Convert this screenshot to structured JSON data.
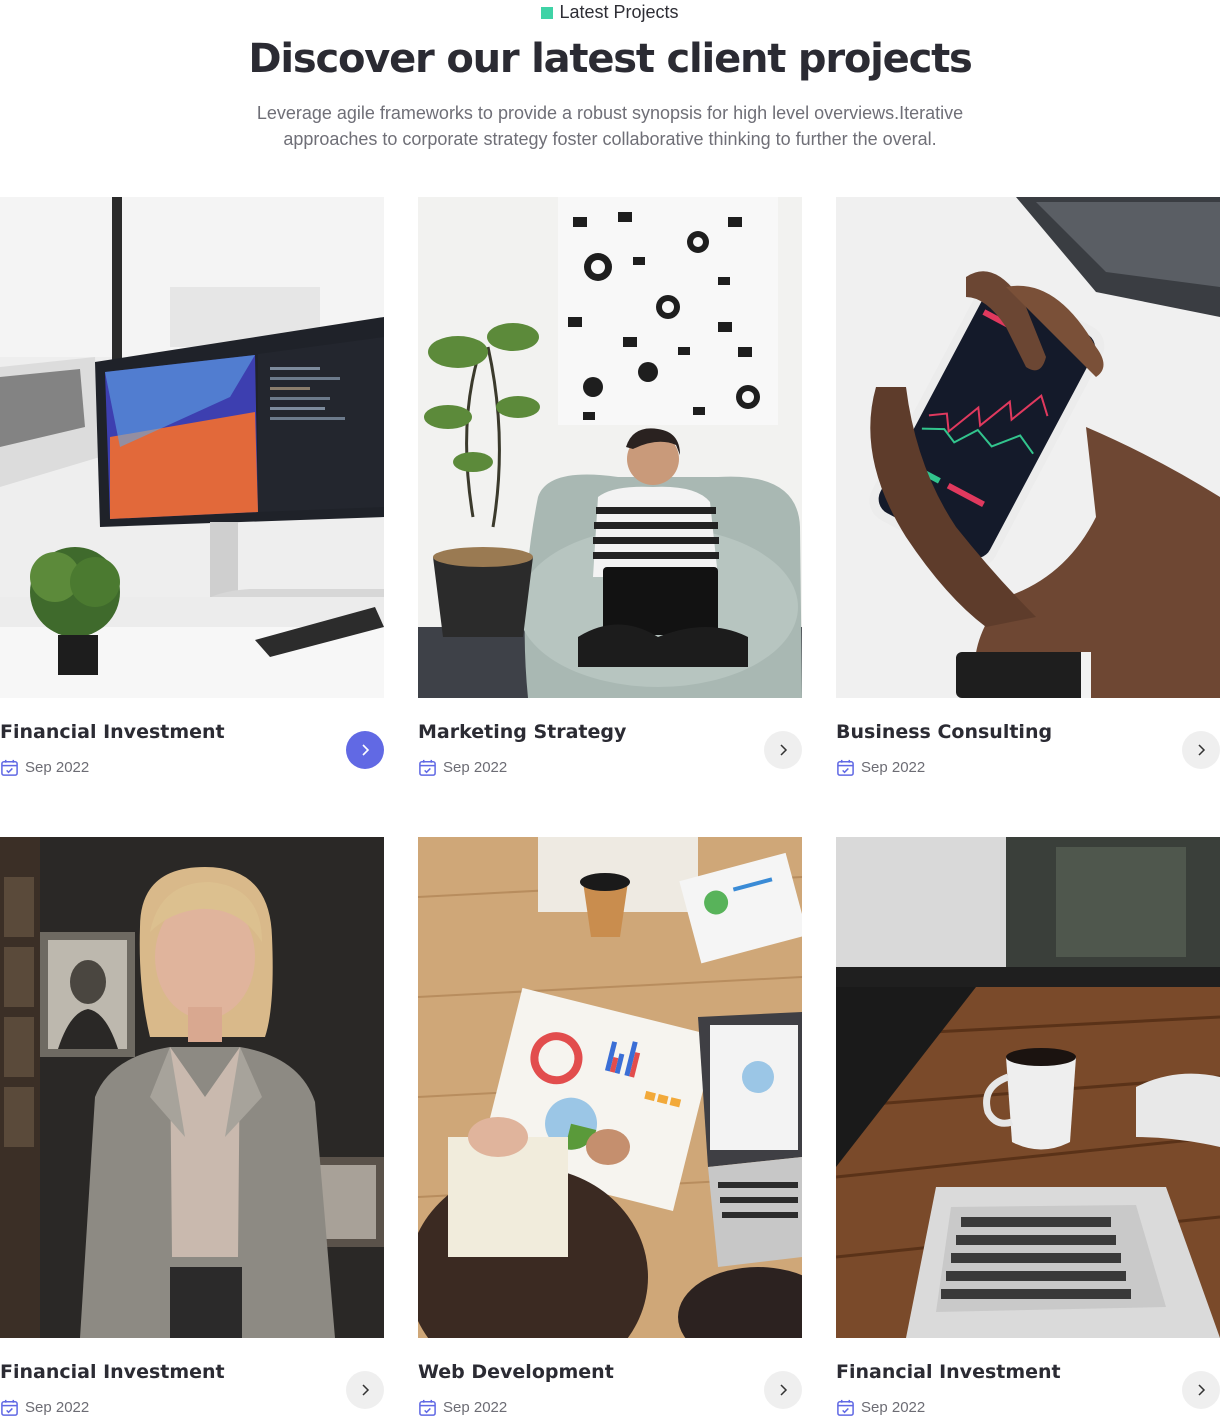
{
  "header": {
    "eyebrow": "Latest Projects",
    "title": "Discover our latest client projects",
    "subtitle": "Leverage agile frameworks to provide a robust synopsis for high level overviews.Iterative approaches to corporate strategy foster collaborative thinking to further the overal."
  },
  "colors": {
    "accent_dot": "#3fd3a6",
    "active_button": "#6169e4",
    "calendar_icon": "#6169e4"
  },
  "projects": [
    {
      "title": "Financial Investment",
      "date": "Sep 2022",
      "image": "monitor-desk-photo",
      "active": true
    },
    {
      "title": "Marketing Strategy",
      "date": "Sep 2022",
      "image": "man-on-beanbag-photo",
      "active": false
    },
    {
      "title": "Business Consulting",
      "date": "Sep 2022",
      "image": "phone-trading-chart-photo",
      "active": false
    },
    {
      "title": "Financial Investment",
      "date": "Sep 2022",
      "image": "businesswoman-portrait-photo",
      "active": false
    },
    {
      "title": "Web Development",
      "date": "Sep 2022",
      "image": "meeting-charts-table-photo",
      "active": false
    },
    {
      "title": "Financial Investment",
      "date": "Sep 2022",
      "image": "coffee-laptop-desk-photo",
      "active": false
    }
  ]
}
